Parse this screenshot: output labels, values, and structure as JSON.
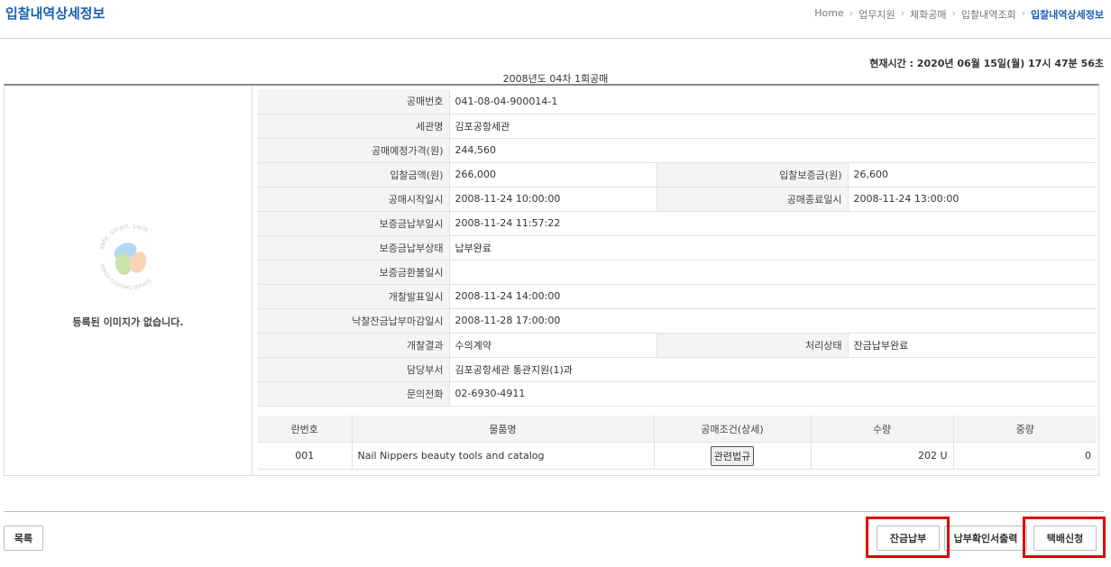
{
  "page_title": "입찰내역상세정보",
  "breadcrumb": [
    "Home",
    "업무지원",
    "체화공매",
    "입찰내역조회",
    "입찰내역상세정보"
  ],
  "current_time": "현재시간 : 2020년 06월 15일(월) 17시 47분 56초",
  "caption": "2008년도 04차 1회공매",
  "no_image_text": "등록된 이미지가 없습니다.",
  "logo_text": {
    "top": "safe, smart, swift",
    "bottom": "KOREA CUSTOMS SERVICE"
  },
  "info": {
    "auction_no": {
      "label": "공매번호",
      "value": "041-08-04-900014-1"
    },
    "customs": {
      "label": "세관명",
      "value": "김포공항세관"
    },
    "expected_price": {
      "label": "공매예정가격(원)",
      "value": "244,560"
    },
    "bid_amount": {
      "label": "입찰금액(원)",
      "value": "266,000"
    },
    "deposit": {
      "label": "입찰보증금(원)",
      "value": "26,600"
    },
    "start_dt": {
      "label": "공매시작일시",
      "value": "2008-11-24 10:00:00"
    },
    "end_dt": {
      "label": "공매종료일시",
      "value": "2008-11-24 13:00:00"
    },
    "deposit_paid_dt": {
      "label": "보증금납부일시",
      "value": "2008-11-24 11:57:22"
    },
    "deposit_status": {
      "label": "보증금납부상태",
      "value": "납부완료"
    },
    "deposit_refund_dt": {
      "label": "보증금환불일시",
      "value": ""
    },
    "open_dt": {
      "label": "개찰발표일시",
      "value": "2008-11-24 14:00:00"
    },
    "balance_deadline": {
      "label": "낙찰잔금납부마감일시",
      "value": "2008-11-28 17:00:00"
    },
    "open_result": {
      "label": "개찰결과",
      "value": "수의계약"
    },
    "process_status": {
      "label": "처리상태",
      "value": "잔금납부완료"
    },
    "dept": {
      "label": "담당부서",
      "value": "김포공항세관  통관지원(1)과"
    },
    "phone": {
      "label": "문의전화",
      "value": "02-6930-4911"
    }
  },
  "items": {
    "headers": [
      "란번호",
      "물품명",
      "공매조건(상세)",
      "수량",
      "중량"
    ],
    "rows": [
      {
        "no": "001",
        "name": "Nail Nippers beauty tools and catalog",
        "cond_button": "관련법규",
        "qty": "202 U",
        "weight": "0"
      }
    ]
  },
  "buttons": {
    "list": "목록",
    "balance_pay": "잔금납부",
    "payment_cert": "납부확인서출력",
    "delivery": "택배신청"
  },
  "highlight_color": "#e00000",
  "accent_color": "#1a5fb4"
}
